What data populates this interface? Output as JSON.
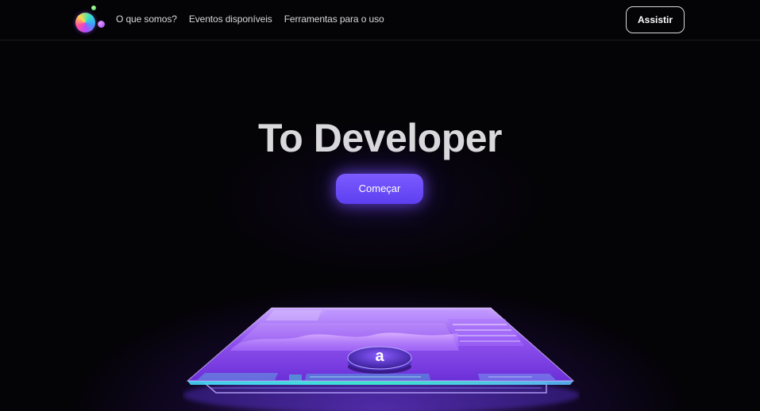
{
  "nav": {
    "links": [
      "O que somos?",
      "Eventos disponíveis",
      "Ferramentas para o uso"
    ],
    "cta_label": "Assistir"
  },
  "hero": {
    "title": "To Developer",
    "button_label": "Começar"
  },
  "platform": {
    "logo_letter": "a"
  },
  "colors": {
    "accent": "#6a4bff",
    "background": "#040306",
    "platform_purple": "#8a4de8",
    "platform_teal": "#1fc7c9"
  }
}
